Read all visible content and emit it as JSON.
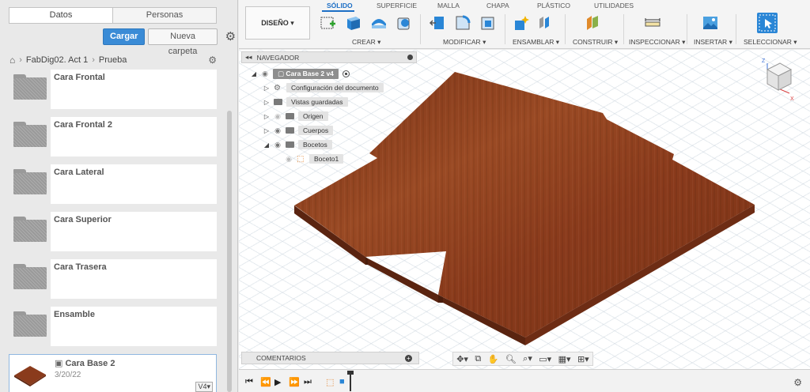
{
  "data_panel": {
    "tabs": [
      "Datos",
      "Personas"
    ],
    "upload_label": "Cargar",
    "new_folder_label": "Nueva carpeta",
    "breadcrumb": [
      "FabDig02. Act 1",
      "Prueba"
    ],
    "folders": [
      "Cara Frontal",
      "Cara Frontal 2",
      "Cara Lateral",
      "Cara Superior",
      "Cara Trasera",
      "Ensamble"
    ],
    "design_item": {
      "name": "Cara Base 2",
      "date": "3/20/22",
      "version": "V4"
    }
  },
  "toolbar": {
    "workspace_label": "DISEÑO",
    "tabs": [
      "SÓLIDO",
      "SUPERFICIE",
      "MALLA",
      "CHAPA",
      "PLÁSTICO",
      "UTILIDADES"
    ],
    "groups": [
      "CREAR",
      "MODIFICAR",
      "ENSAMBLAR",
      "CONSTRUIR",
      "INSPECCIONAR",
      "INSERTAR",
      "SELECCIONAR"
    ]
  },
  "navigator": {
    "title": "NAVEGADOR",
    "root": "Cara Base 2 v4",
    "items": [
      "Configuración del documento",
      "Vistas guardadas",
      "Origen",
      "Cuerpos",
      "Bocetos",
      "Boceto1"
    ]
  },
  "comments_label": "COMENTARIOS",
  "colors": {
    "accent": "#1d6fc5",
    "wood": "#8a3b1c",
    "button": "#3a8bd6"
  }
}
